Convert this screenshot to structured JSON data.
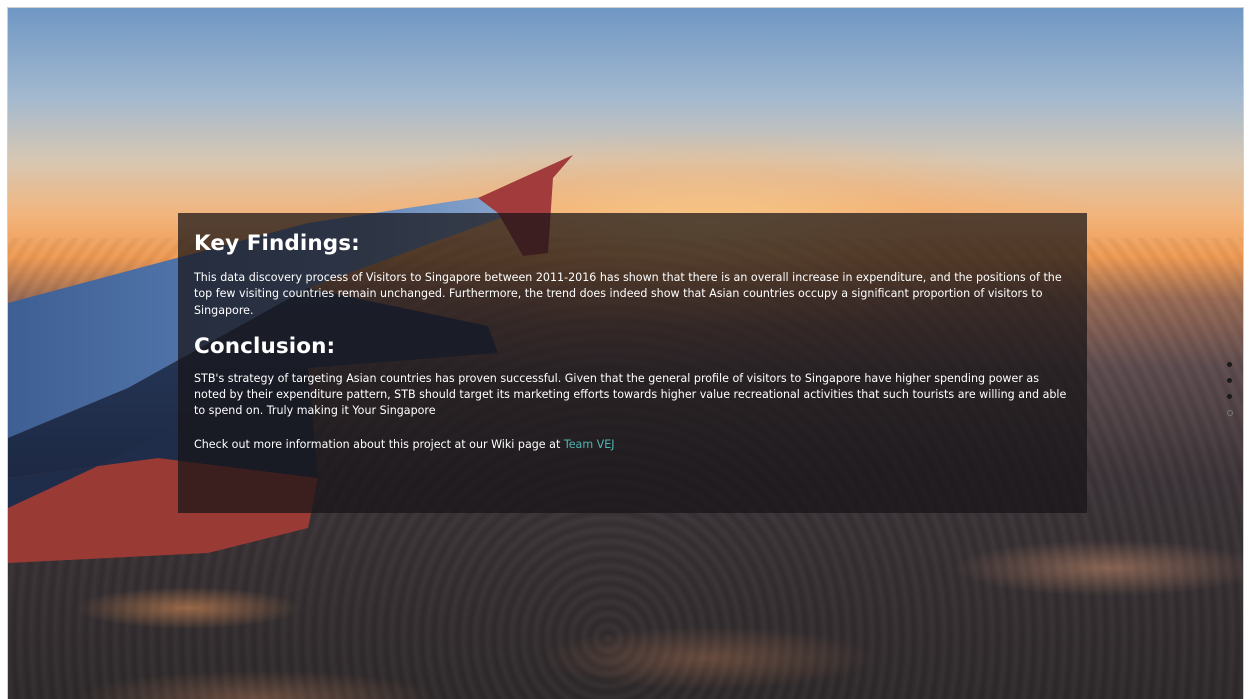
{
  "slide": {
    "key_findings": {
      "heading": "Key Findings:",
      "text": "This data discovery process of Visitors to Singapore between 2011-2016 has shown that there is an overall increase in expenditure, and the positions of the top few visiting countries remain unchanged. Furthermore, the trend does indeed show that Asian countries occupy a significant proportion of visitors to Singapore."
    },
    "conclusion": {
      "heading": "Conclusion:",
      "text": "STB's strategy of targeting Asian countries has proven successful. Given that the general profile of visitors to Singapore have higher spending power as noted by their expenditure pattern, STB should target its marketing efforts towards higher value recreational activities that such tourists are willing and able to spend on. Truly making it Your Singapore",
      "cta_prefix": "Check out more information about this project at our Wiki page at ",
      "cta_link": "Team VEJ",
      "link_color": "#4fb7b2"
    }
  },
  "nav_dots": {
    "count": 4,
    "active_index": 3
  }
}
